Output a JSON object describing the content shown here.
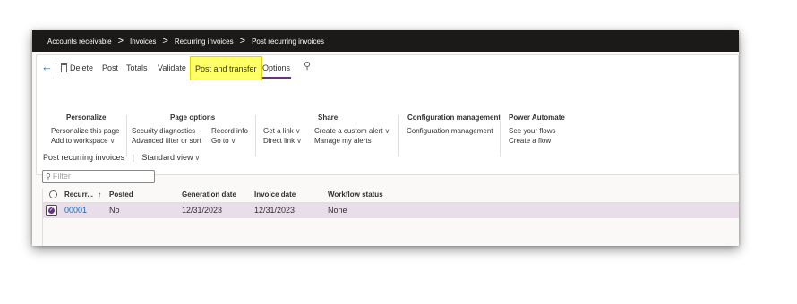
{
  "breadcrumb": [
    "Accounts receivable",
    "Invoices",
    "Recurring invoices",
    "Post recurring invoices"
  ],
  "breadcrumb_separator": ">",
  "action_bar": {
    "back_icon": "back-arrow-icon",
    "delete_icon": "trash-icon",
    "delete_label": "Delete",
    "post_label": "Post",
    "totals_label": "Totals",
    "validate_label": "Validate",
    "post_transfer_label": "Post and transfer",
    "options_label": "Options",
    "search_icon": "search-icon",
    "highlight_color": "#ffff66",
    "accent_color": "#6b2f8b"
  },
  "groups": {
    "personalize": {
      "title": "Personalize",
      "items": [
        "Personalize this page",
        "Add to workspace"
      ]
    },
    "page_options": {
      "title": "Page options",
      "col1": [
        "Security diagnostics",
        "Advanced filter or sort"
      ],
      "col2": [
        "Record info",
        "Go to"
      ]
    },
    "share": {
      "title": "Share",
      "col1": [
        "Get a link",
        "Direct link"
      ],
      "col2": [
        "Create a custom alert",
        "Manage my alerts"
      ]
    },
    "configuration": {
      "title": "Configuration management",
      "items": [
        "Configuration management"
      ]
    },
    "power_automate": {
      "title": "Power Automate",
      "items": [
        "See your flows",
        "Create a flow"
      ]
    }
  },
  "chevron": "∨",
  "view": {
    "page_name": "Post recurring invoices",
    "separator": "|",
    "view_name": "Standard view"
  },
  "filter": {
    "placeholder": "Filter"
  },
  "grid": {
    "columns": [
      "Recurr...",
      "Posted",
      "Generation date",
      "Invoice date",
      "Workflow status"
    ],
    "sort_indicator": "↑",
    "rows": [
      {
        "recurr": "00001",
        "posted": "No",
        "generation_date": "12/31/2023",
        "invoice_date": "12/31/2023",
        "workflow_status": "None"
      }
    ]
  }
}
